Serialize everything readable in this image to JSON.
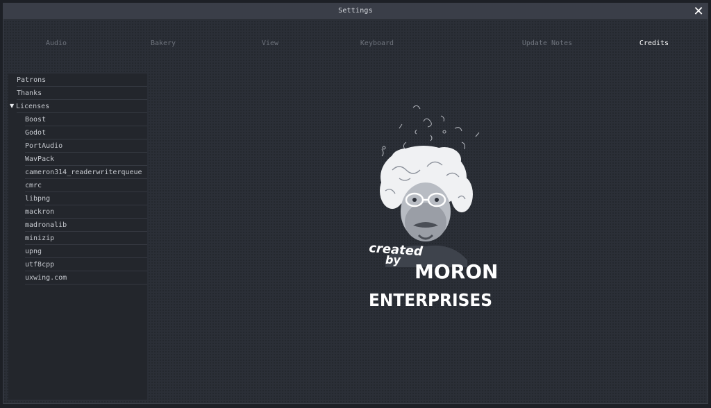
{
  "window": {
    "title": "Settings",
    "close_glyph": "✕"
  },
  "tabs": [
    {
      "label": "Audio",
      "active": false
    },
    {
      "label": "Bakery",
      "active": false
    },
    {
      "label": "View",
      "active": false
    },
    {
      "label": "Keyboard",
      "active": false
    },
    {
      "label": "Update Notes",
      "active": false
    },
    {
      "label": "Credits",
      "active": true
    }
  ],
  "sidebar": {
    "items": [
      {
        "label": "Patrons"
      },
      {
        "label": "Thanks"
      },
      {
        "label": "Licenses",
        "expanded": true,
        "icon": "chevron-down-icon"
      }
    ],
    "licenses": [
      {
        "label": "Boost"
      },
      {
        "label": "Godot"
      },
      {
        "label": "PortAudio"
      },
      {
        "label": "WavPack"
      },
      {
        "label": "cameron314_readerwriterqueue"
      },
      {
        "label": "cmrc"
      },
      {
        "label": "libpng"
      },
      {
        "label": "mackron"
      },
      {
        "label": "madronalib"
      },
      {
        "label": "minizip"
      },
      {
        "label": "upng"
      },
      {
        "label": "utf8cpp"
      },
      {
        "label": "uxwing.com"
      }
    ]
  },
  "credits": {
    "logo_line1": "created",
    "logo_line2": "by",
    "logo_line3": "MORON",
    "logo_line4": "ENTERPRISES"
  },
  "colors": {
    "background": "#2b2f37",
    "titlebar": "#3a3e48",
    "sidebar": "#23262c",
    "tab_inactive": "#6f747d",
    "tab_active": "#ffffff"
  }
}
